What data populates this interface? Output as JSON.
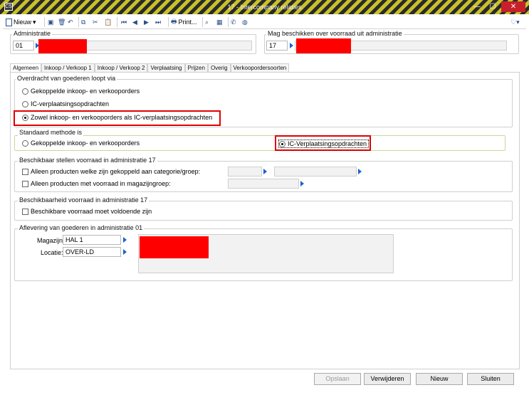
{
  "window": {
    "title": "17 - Intercompany relaties",
    "app_icon": "CS"
  },
  "toolbar": {
    "new_label": "Nieuw",
    "print_label": "Print..."
  },
  "header": {
    "admin_label": "Administratie",
    "admin_value": "01",
    "stock_label": "Mag beschikken over voorraad uit administratie",
    "stock_value": "17"
  },
  "tabs": [
    "Algemeen",
    "Inkoop / Verkoop 1",
    "Inkoop / Verkoop 2",
    "Verplaatsing",
    "Prijzen",
    "Overig",
    "Verkoopordersoorten"
  ],
  "transfer": {
    "title": "Overdracht van goederen loopt via",
    "options": [
      "Gekoppelde inkoop- en verkooporders",
      "IC-verplaatsingsopdrachten",
      "Zowel inkoop- en verkooporders als IC-verplaatsingsopdrachten"
    ]
  },
  "standard": {
    "title": "Standaard methode is",
    "options": [
      "Gekoppelde inkoop- en verkooporders",
      "IC-Verplaatsingsopdrachten"
    ]
  },
  "availability": {
    "title": "Beschikbaar stellen voorraad in administratie 17",
    "opt1": "Alleen producten welke zijn gekoppeld aan categorie/groep:",
    "opt2": "Alleen producten met voorraad in magazijngroep:"
  },
  "availability2": {
    "title": "Beschikbaarheid voorraad in administratie 17",
    "opt1": "Beschikbare voorraad moet voldoende zijn"
  },
  "delivery": {
    "title": "Aflevering van goederen in administratie 01",
    "warehouse_label": "Magazijn:",
    "warehouse_value": "HAL 1",
    "location_label": "Locatie:",
    "location_value": "OVER-LD"
  },
  "buttons": {
    "save": "Opslaan",
    "delete": "Verwijderen",
    "new": "Nieuw",
    "close": "Sluiten"
  },
  "colors": {
    "highlight": "#e00000",
    "redaction": "#ff0000",
    "close_button": "#c8202b"
  }
}
